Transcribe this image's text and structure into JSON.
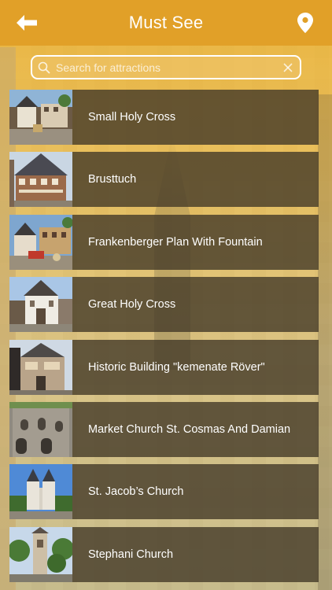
{
  "header": {
    "title": "Must See",
    "back_icon": "arrow-left-icon",
    "map_icon": "map-pin-icon"
  },
  "search": {
    "placeholder": "Search for attractions",
    "value": ""
  },
  "attractions": [
    {
      "name": "Small Holy Cross",
      "thumb": "half-timbered-square-photo"
    },
    {
      "name": "Brusttuch",
      "thumb": "brusttuch-house-photo"
    },
    {
      "name": "Frankenberger Plan With Fountain",
      "thumb": "fountain-plaza-photo"
    },
    {
      "name": "Great Holy Cross",
      "thumb": "white-chapel-photo"
    },
    {
      "name": "Historic Building \"kemenate Röver\"",
      "thumb": "stone-house-photo"
    },
    {
      "name": "Market Church St. Cosmas And Damian",
      "thumb": "stone-wall-photo"
    },
    {
      "name": "St. Jacob’s Church",
      "thumb": "twin-tower-church-photo"
    },
    {
      "name": "Stephani Church",
      "thumb": "church-tower-trees-photo"
    }
  ],
  "colors": {
    "header_bg": "#e1a028",
    "row_bg": "#433a28",
    "text": "#ffffff"
  }
}
